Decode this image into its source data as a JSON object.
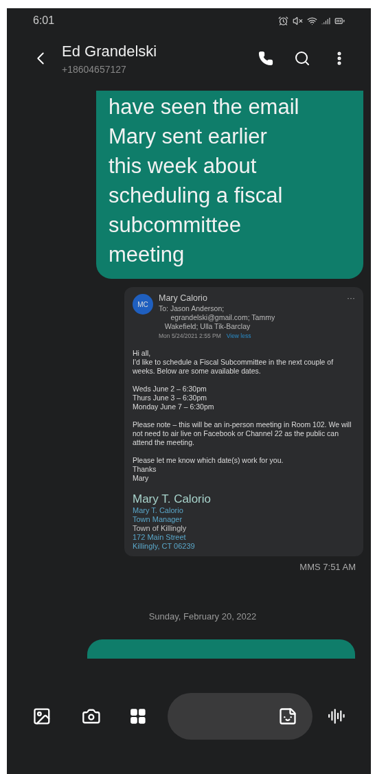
{
  "status_bar": {
    "time": "6:01"
  },
  "header": {
    "name": "Ed Grandelski",
    "number": "+18604657127"
  },
  "sent_message": {
    "text": "have seen the email\nMary sent earlier\nthis week about\nscheduling a fiscal\nsubcommittee\nmeeting"
  },
  "email": {
    "avatar": "MC",
    "sender": "Mary Calorio",
    "menu": "···",
    "to": "To: Jason Anderson;\n      egrandelski@gmail.com; Tammy\n   Wakefield; Ulla Tik-Barclay",
    "date": "Mon 5/24/2021 2:55 PM",
    "link": "View less",
    "paragraphs": [
      "Hi all,\nI'd like to schedule a Fiscal Subcommittee in the next couple of weeks.  Below are some available dates.",
      "Weds June 2 – 6:30pm\nThurs June 3 – 6:30pm\nMonday June 7 – 6:30pm",
      "Please note – this will be an in-person meeting in Room 102.  We will not need to air live on Facebook or Channel 22 as the public can attend the meeting.",
      "Please let me know which date(s) work for you.\nThanks\nMary"
    ],
    "signature_name": "Mary T. Calorio",
    "signature_lines": [
      {
        "text": "Mary T. Calorio",
        "kind": "link"
      },
      {
        "text": "Town Manager",
        "kind": "link"
      },
      {
        "text": "Town of Killingly",
        "kind": "plain"
      },
      {
        "text": "172 Main Street",
        "kind": "link"
      },
      {
        "text": "Killingly, CT 06239",
        "kind": "link"
      }
    ]
  },
  "mms_time": "MMS 7:51 AM",
  "date_divider": "Sunday, February 20, 2022"
}
